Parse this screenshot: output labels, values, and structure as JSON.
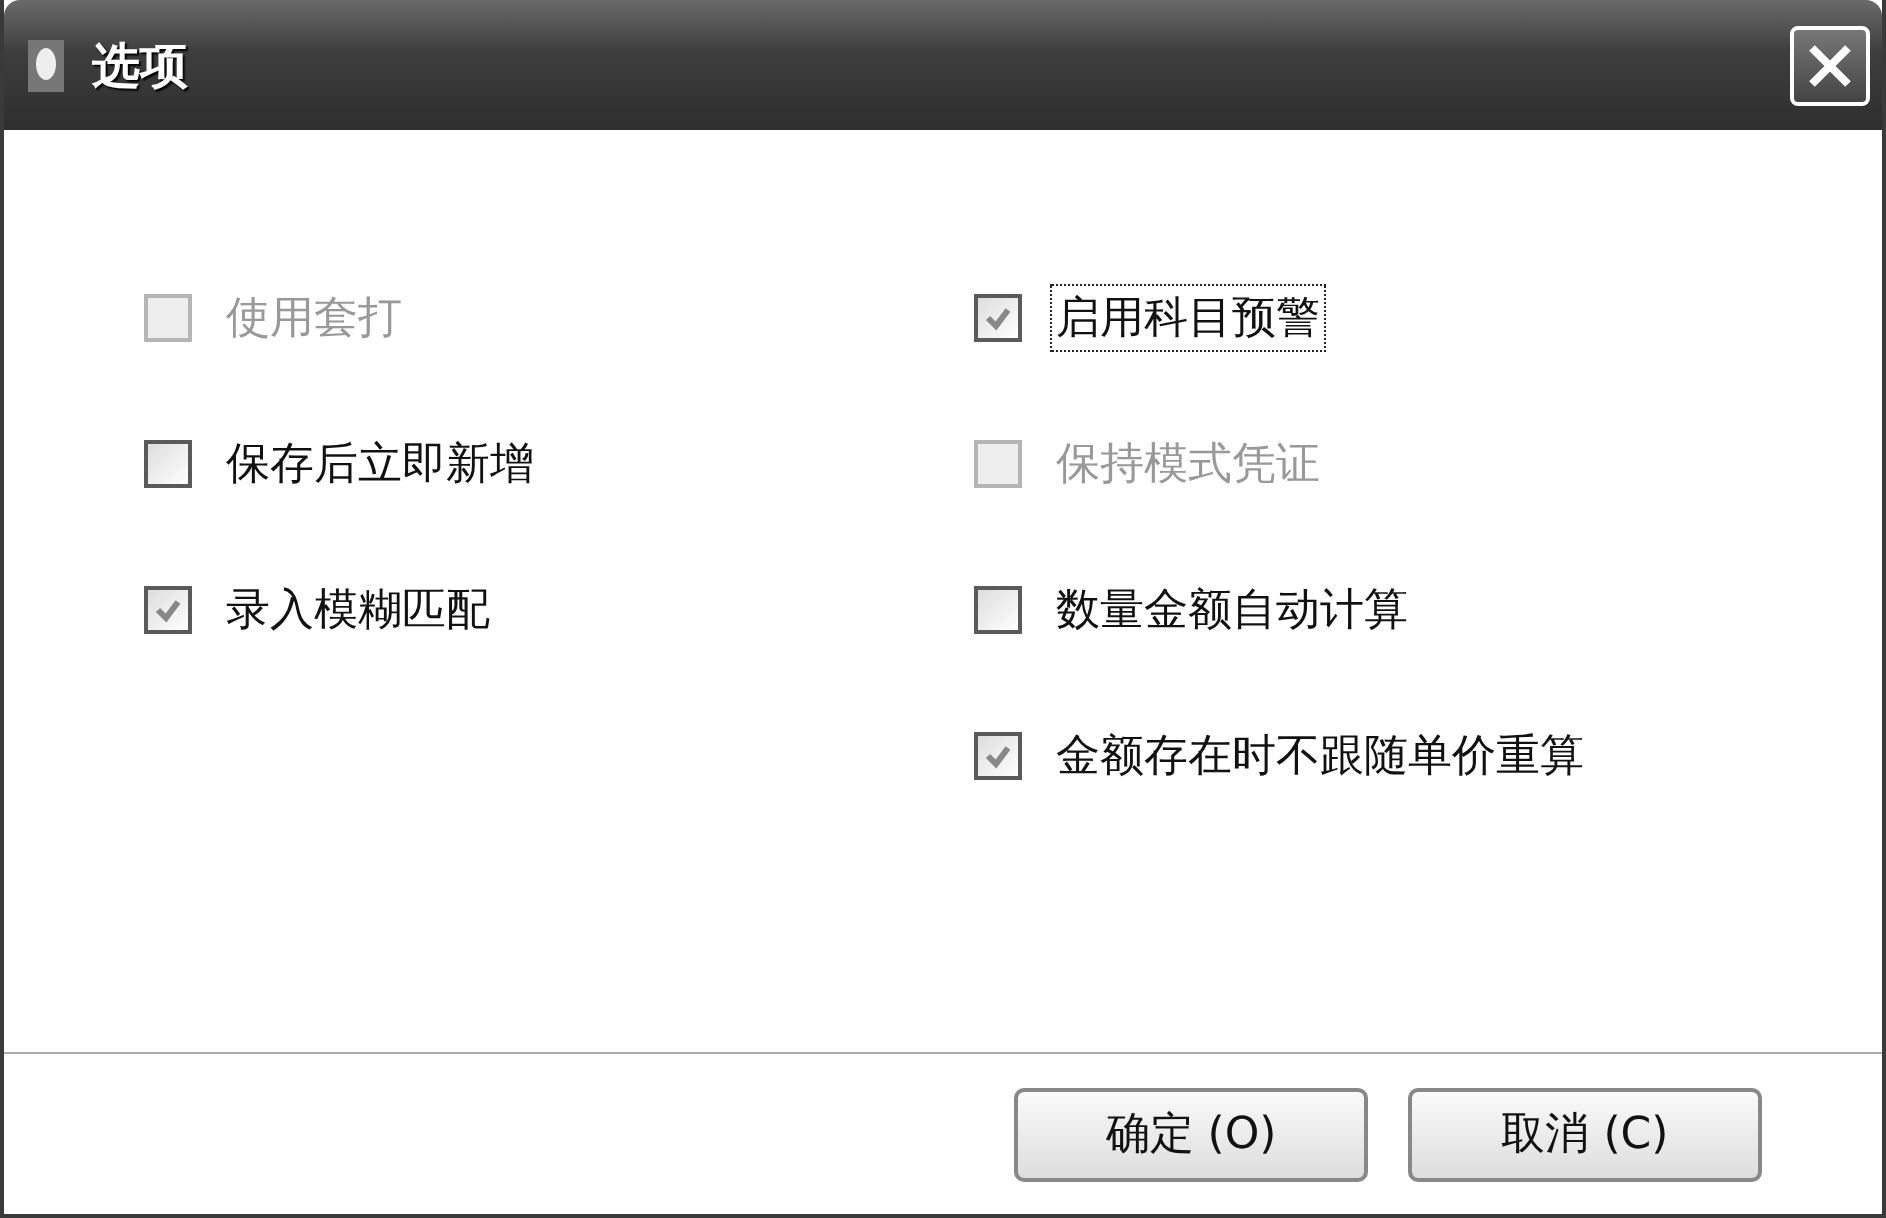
{
  "window": {
    "title": "选项"
  },
  "columns": [
    [
      {
        "label": "使用套打",
        "checked": false,
        "disabled": true,
        "focused": false
      },
      {
        "label": "保存后立即新增",
        "checked": false,
        "disabled": false,
        "focused": false
      },
      {
        "label": "录入模糊匹配",
        "checked": true,
        "disabled": false,
        "focused": false
      }
    ],
    [
      {
        "label": "启用科目预警",
        "checked": true,
        "disabled": false,
        "focused": true
      },
      {
        "label": "保持模式凭证",
        "checked": false,
        "disabled": true,
        "focused": false
      },
      {
        "label": "数量金额自动计算",
        "checked": false,
        "disabled": false,
        "focused": false
      },
      {
        "label": "金额存在时不跟随单价重算",
        "checked": true,
        "disabled": false,
        "focused": false
      }
    ]
  ],
  "buttons": [
    "确定 (O)",
    "取消 (C)"
  ]
}
